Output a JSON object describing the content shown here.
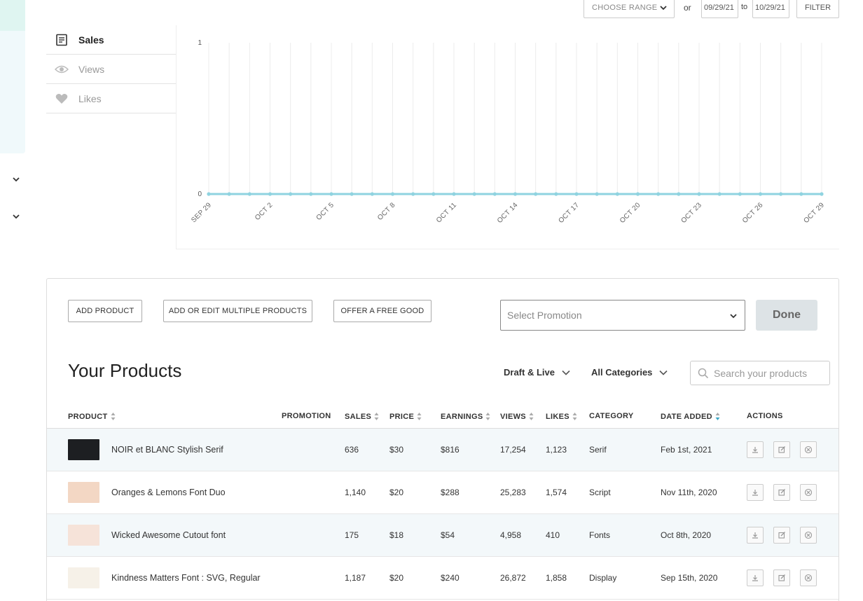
{
  "filters": {
    "range_placeholder": "CHOOSE RANGE",
    "or_label": "or",
    "date_from": "09/29/21",
    "to_label": "to",
    "date_to": "10/29/21",
    "filter_label": "FILTER"
  },
  "metrics": [
    {
      "label": "Sales",
      "icon": "register-icon",
      "active": true
    },
    {
      "label": "Views",
      "icon": "eye-icon",
      "active": false
    },
    {
      "label": "Likes",
      "icon": "heart-icon",
      "active": false
    }
  ],
  "chart_data": {
    "type": "line",
    "x": [
      "SEP 29",
      "SEP 30",
      "OCT 1",
      "OCT 2",
      "OCT 3",
      "OCT 4",
      "OCT 5",
      "OCT 6",
      "OCT 7",
      "OCT 8",
      "OCT 9",
      "OCT 10",
      "OCT 11",
      "OCT 12",
      "OCT 13",
      "OCT 14",
      "OCT 15",
      "OCT 16",
      "OCT 17",
      "OCT 18",
      "OCT 19",
      "OCT 20",
      "OCT 21",
      "OCT 22",
      "OCT 23",
      "OCT 24",
      "OCT 25",
      "OCT 26",
      "OCT 27",
      "OCT 28",
      "OCT 29"
    ],
    "tick_labels": [
      "SEP 29",
      "OCT 2",
      "OCT 5",
      "OCT 8",
      "OCT 11",
      "OCT 14",
      "OCT 17",
      "OCT 20",
      "OCT 23",
      "OCT 26",
      "OCT 29"
    ],
    "series": [
      {
        "values": [
          0,
          0,
          0,
          0,
          0,
          0,
          0,
          0,
          0,
          0,
          0,
          0,
          0,
          0,
          0,
          0,
          0,
          0,
          0,
          0,
          0,
          0,
          0,
          0,
          0,
          0,
          0,
          0,
          0,
          0,
          0
        ]
      }
    ],
    "ylim": [
      0,
      1
    ],
    "y_ticks": [
      "0",
      "1"
    ],
    "grid": true,
    "line_color": "#8fd3e0"
  },
  "toolbar": {
    "add_product": "ADD PRODUCT",
    "add_multiple": "ADD OR EDIT MULTIPLE PRODUCTS",
    "offer_free": "OFFER A FREE GOOD",
    "promotion_placeholder": "Select Promotion",
    "done": "Done"
  },
  "products_section": {
    "title": "Your Products",
    "status_filter": "Draft & Live",
    "category_filter": "All Categories",
    "search_placeholder": "Search your products"
  },
  "columns": {
    "product": "PRODUCT",
    "promotion": "PROMOTION",
    "sales": "SALES",
    "price": "PRICE",
    "earnings": "EARNINGS",
    "views": "VIEWS",
    "likes": "LIKES",
    "category": "CATEGORY",
    "date_added": "DATE ADDED",
    "actions": "ACTIONS"
  },
  "products": [
    {
      "name": "NOIR et BLANC Stylish Serif",
      "promotion": "",
      "sales": "636",
      "price": "$30",
      "earnings": "$816",
      "views": "17,254",
      "likes": "1,123",
      "category": "Serif",
      "date_added": "Feb 1st, 2021",
      "thumb_color": "#1d1f22"
    },
    {
      "name": "Oranges & Lemons Font Duo",
      "promotion": "",
      "sales": "1,140",
      "price": "$20",
      "earnings": "$288",
      "views": "25,283",
      "likes": "1,574",
      "category": "Script",
      "date_added": "Nov 11th, 2020",
      "thumb_color": "#f3d7c4"
    },
    {
      "name": "Wicked Awesome Cutout font",
      "promotion": "",
      "sales": "175",
      "price": "$18",
      "earnings": "$54",
      "views": "4,958",
      "likes": "410",
      "category": "Fonts",
      "date_added": "Oct 8th, 2020",
      "thumb_color": "#f6e3d9"
    },
    {
      "name": "Kindness Matters Font : SVG, Regular",
      "promotion": "",
      "sales": "1,187",
      "price": "$20",
      "earnings": "$240",
      "views": "26,872",
      "likes": "1,858",
      "category": "Display",
      "date_added": "Sep 15th, 2020",
      "thumb_color": "#f6f1e8"
    }
  ]
}
